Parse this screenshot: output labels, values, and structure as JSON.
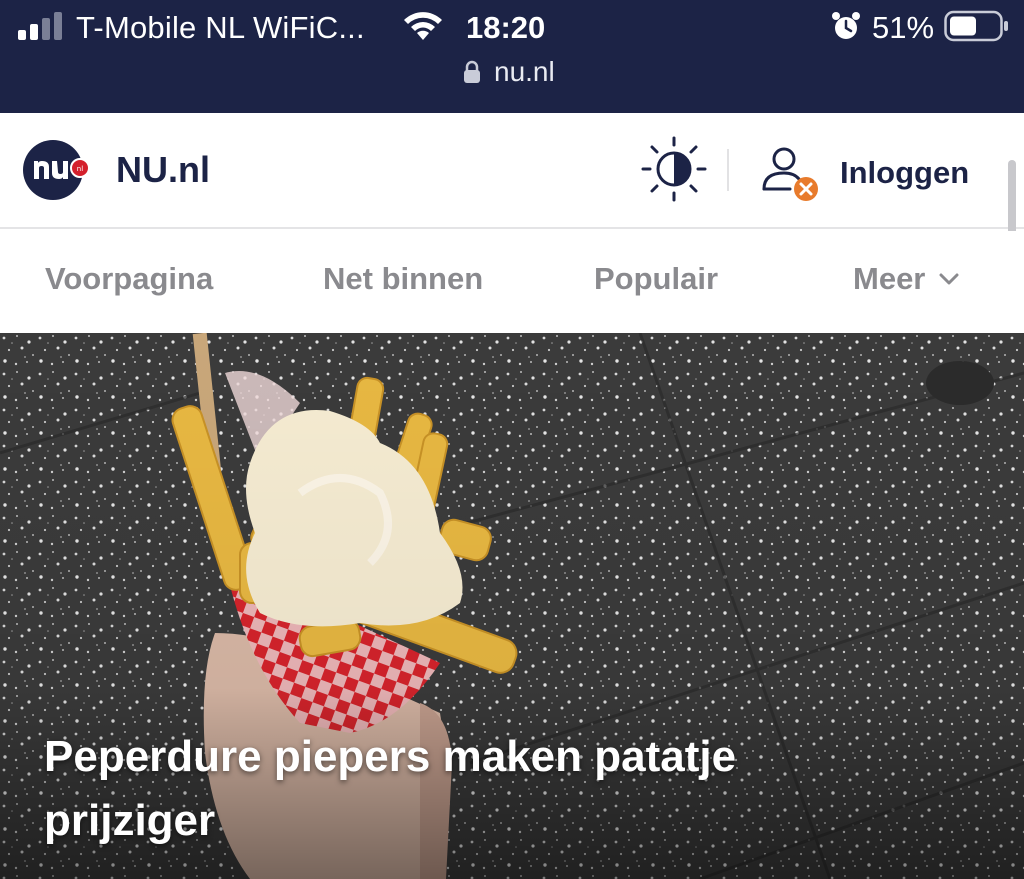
{
  "status_bar": {
    "carrier": "T-Mobile  NL WiFiC...",
    "time": "18:20",
    "battery": "51%",
    "url": "nu.nl",
    "icons": [
      "signal-icon",
      "wifi-icon",
      "alarm-icon",
      "battery-icon",
      "lock-icon"
    ]
  },
  "header": {
    "site_name": "NU.nl",
    "logo_text": "nu",
    "login_label": "Inloggen"
  },
  "nav": {
    "items": [
      {
        "label": "Voorpagina"
      },
      {
        "label": "Net binnen"
      },
      {
        "label": "Populair"
      },
      {
        "label": "Meer"
      }
    ]
  },
  "hero": {
    "title": "Peperdure piepers maken patatje prijziger"
  },
  "colors": {
    "navy": "#1c2346",
    "nav_gray": "#8a8a8e",
    "badge_orange": "#e87b2c",
    "logo_red": "#d4202c"
  }
}
